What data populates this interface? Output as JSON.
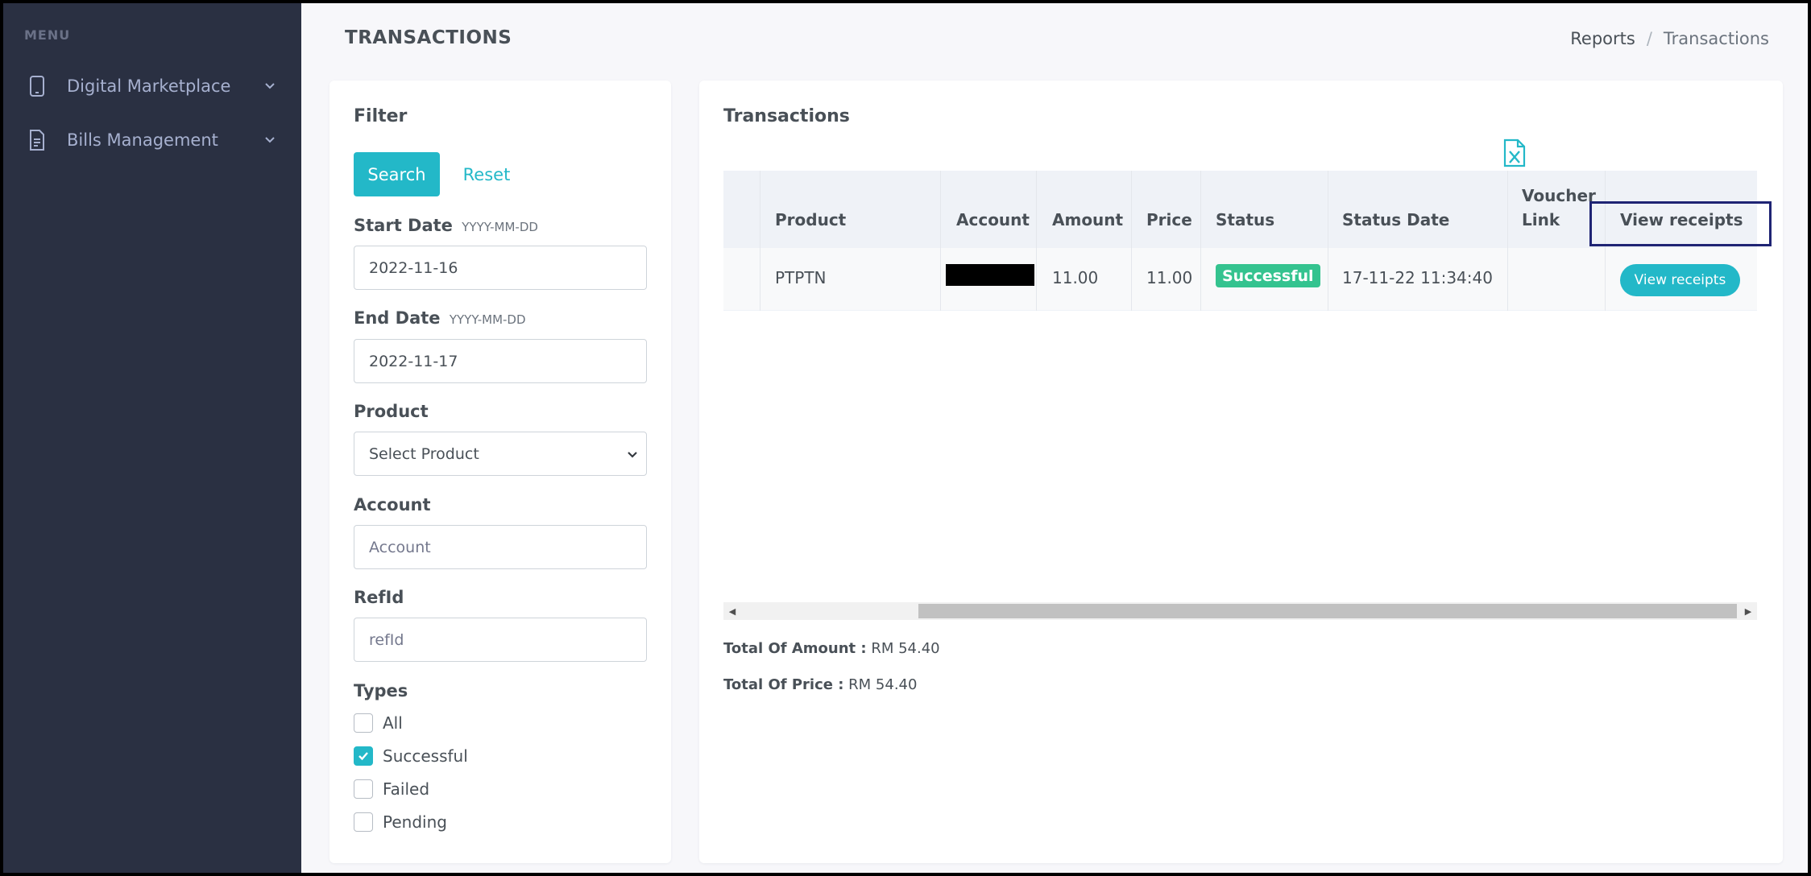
{
  "sidebar": {
    "menu_title": "MENU",
    "items": [
      {
        "label": "Digital Marketplace",
        "icon": "tablet-icon"
      },
      {
        "label": "Bills Management",
        "icon": "document-icon"
      }
    ]
  },
  "header": {
    "title": "TRANSACTIONS",
    "breadcrumb": [
      "Reports",
      "Transactions"
    ],
    "separator": "/"
  },
  "filter": {
    "title": "Filter",
    "search_label": "Search",
    "reset_label": "Reset",
    "start_date": {
      "label": "Start Date",
      "hint": "YYYY-MM-DD",
      "value": "2022-11-16"
    },
    "end_date": {
      "label": "End Date",
      "hint": "YYYY-MM-DD",
      "value": "2022-11-17"
    },
    "product": {
      "label": "Product",
      "selected": "Select Product"
    },
    "account": {
      "label": "Account",
      "placeholder": "Account"
    },
    "refid": {
      "label": "RefId",
      "placeholder": "refId"
    },
    "types": {
      "label": "Types",
      "options": [
        {
          "label": "All",
          "checked": false
        },
        {
          "label": "Successful",
          "checked": true
        },
        {
          "label": "Failed",
          "checked": false
        },
        {
          "label": "Pending",
          "checked": false
        }
      ]
    }
  },
  "transactions": {
    "title": "Transactions",
    "export_icon": "excel-export-icon",
    "columns": [
      "Product",
      "Account",
      "Amount",
      "Price",
      "Status",
      "Status Date",
      "Voucher Link",
      "View receipts"
    ],
    "rows": [
      {
        "product": "PTPTN",
        "account": "",
        "amount": "11.00",
        "price": "11.00",
        "status": "Successful",
        "status_date": "17-11-22 11:34:40",
        "voucher_link": "",
        "action": "View receipts"
      }
    ],
    "totals": {
      "amount_label": "Total Of Amount :",
      "amount_value": "RM 54.40",
      "price_label": "Total Of Price :",
      "price_value": "RM 54.40"
    }
  },
  "colors": {
    "sidebar_bg": "#2a3042",
    "accent": "#23b8c8",
    "success": "#34c38f",
    "highlight": "#1f2474"
  }
}
